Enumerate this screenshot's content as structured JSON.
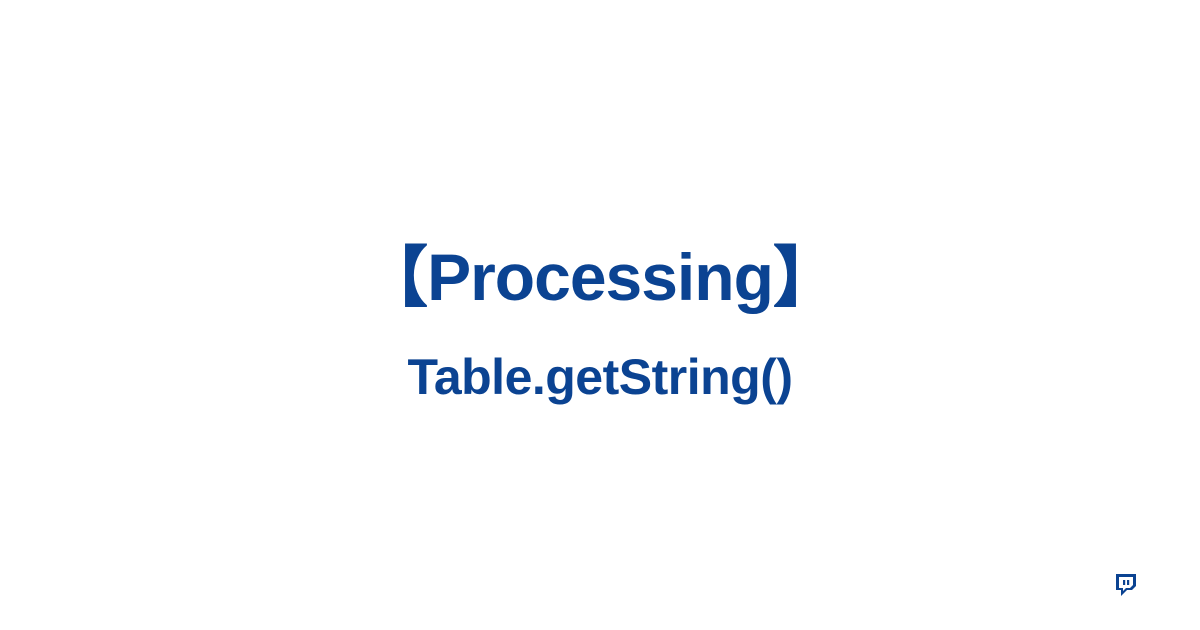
{
  "title": "【Processing】",
  "subtitle": "Table.getString()",
  "colors": {
    "text": "#0b4392",
    "background": "#ffffff"
  },
  "logo": {
    "name": "site-logo-icon"
  }
}
